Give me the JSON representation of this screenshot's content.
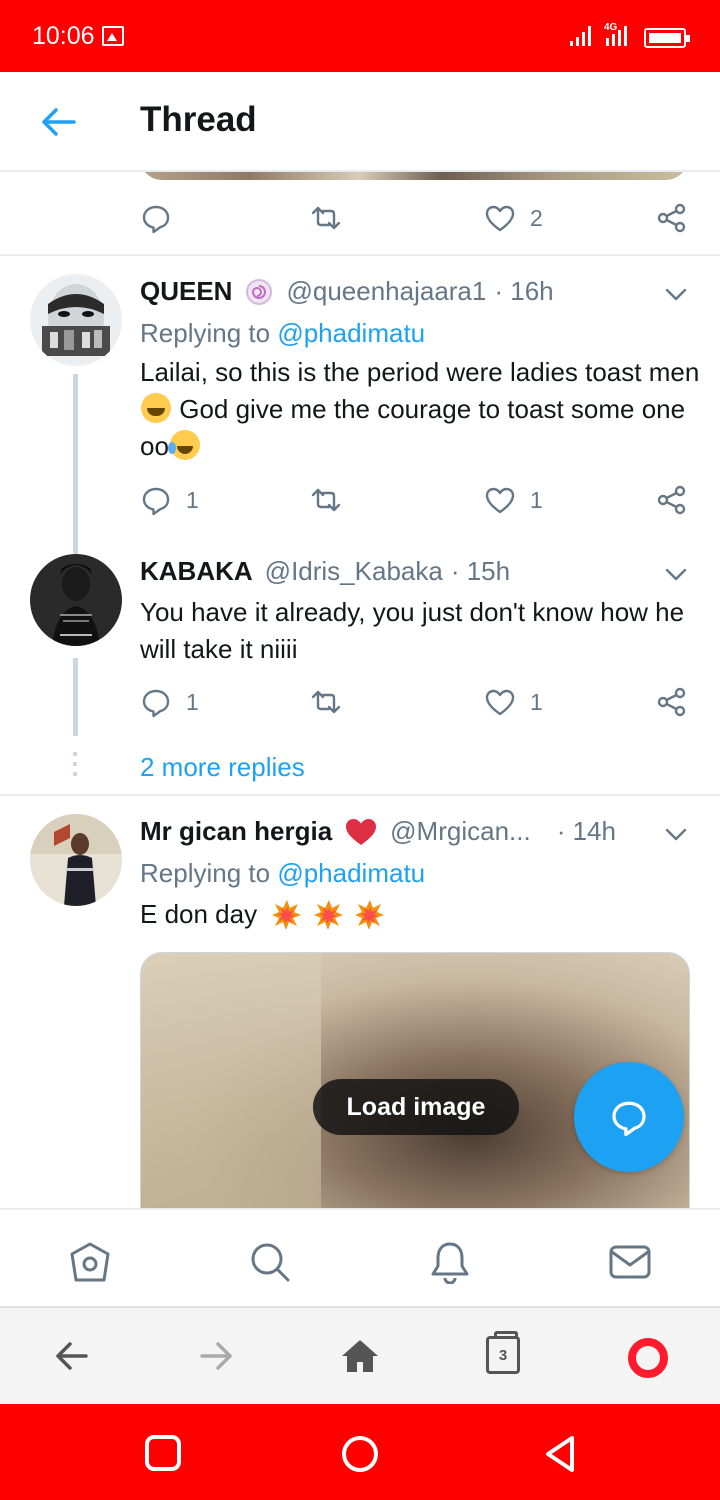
{
  "status_bar": {
    "time": "10:06",
    "network": "4G"
  },
  "header": {
    "title": "Thread"
  },
  "top_tweet_actions": {
    "likes": "2"
  },
  "tweets": [
    {
      "name": "QUEEN",
      "handle": "@queenhajaara1",
      "time": "· 16h",
      "reply_prefix": "Replying to",
      "reply_to": "@phadimatu",
      "text_1": "Lailai, so this is the period were ladies toast men",
      "text_2": " God give me the courage to toast some one oo",
      "replies": "1",
      "likes": "1"
    },
    {
      "name": "KABAKA",
      "handle": "@Idris_Kabaka",
      "time": "· 15h",
      "text": "You have it already, you just don't know how he will take it niiii",
      "replies": "1",
      "likes": "1"
    },
    {
      "name": "Mr gican hergia",
      "handle": "@Mrgican...",
      "time": "· 14h",
      "reply_prefix": "Replying to",
      "reply_to": "@phadimatu",
      "text": "E don day",
      "media_button": "Load image"
    }
  ],
  "more_replies": "2 more replies",
  "browser": {
    "tab_count": "3"
  },
  "colors": {
    "accent": "#1da1f2",
    "system_bar": "#ff0000",
    "muted": "#657786"
  }
}
